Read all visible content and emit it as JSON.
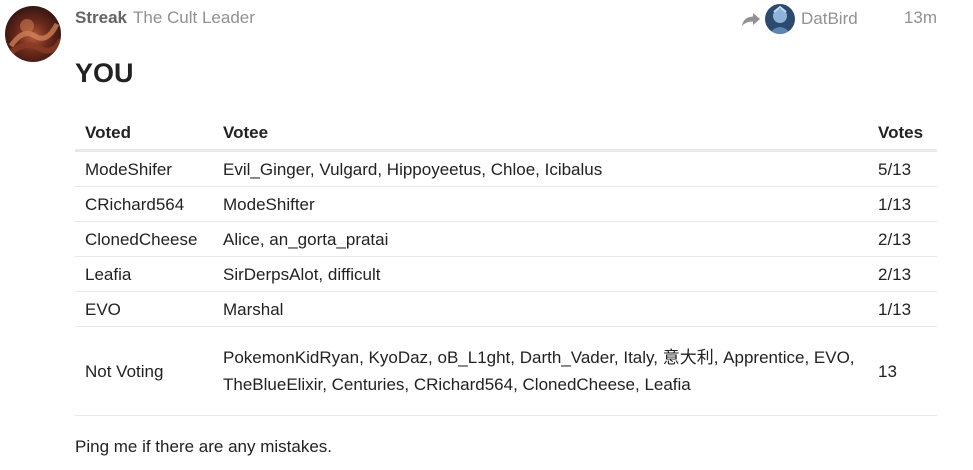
{
  "post": {
    "username": "Streak",
    "user_title": "The Cult Leader",
    "reply_to": "DatBird",
    "age": "13m",
    "heading": "YOU",
    "footer": "Ping me if there are any mistakes."
  },
  "table": {
    "headers": [
      "Voted",
      "Votee",
      "Votes"
    ],
    "rows": [
      [
        "ModeShifer",
        "Evil_Ginger, Vulgard, Hippoyeetus, Chloe, Icibalus",
        "5/13"
      ],
      [
        "CRichard564",
        "ModeShifter",
        "1/13"
      ],
      [
        "ClonedCheese",
        "Alice, an_gorta_pratai",
        "2/13"
      ],
      [
        "Leafia",
        "SirDerpsAlot, difficult",
        "2/13"
      ],
      [
        "EVO",
        "Marshal",
        "1/13"
      ],
      [
        "Not Voting",
        "PokemonKidRyan, KyoDaz, oB_L1ght, Darth_Vader, Italy, 意大利, Apprentice, EVO, TheBlueElixir, Centuries, CRichard564, ClonedCheese, Leafia",
        "13"
      ]
    ]
  },
  "icons": {
    "avatar": "user-avatar-image",
    "reply": "reply-arrow-icon",
    "reply_avatar": "reply-user-avatar-image"
  },
  "colors": {
    "meta_text": "#919191",
    "username": "#646464",
    "body_text": "#222222",
    "divider": "#e9e9e9"
  }
}
